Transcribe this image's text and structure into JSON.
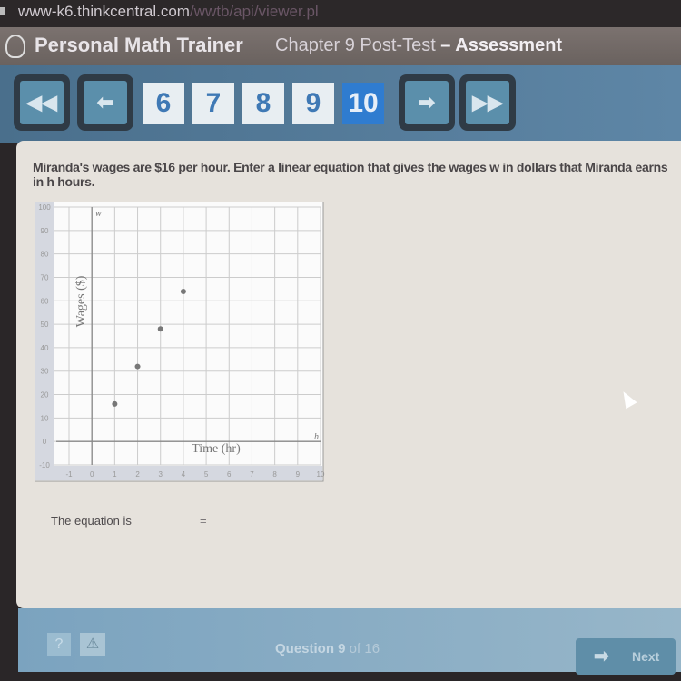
{
  "browser": {
    "url_host": "www-k6.thinkcentral.com",
    "url_path": "/wwtb/api/viewer.pl"
  },
  "header": {
    "app_title": "Personal Math Trainer",
    "chapter": "Chapter 9 Post-Test",
    "separator": " – ",
    "section": "Assessment"
  },
  "nav": {
    "first_icon": "double-left-arrow-icon",
    "prev_icon": "left-arrow-icon",
    "next_icon": "right-arrow-icon",
    "last_icon": "double-right-arrow-icon",
    "questions": [
      "6",
      "7",
      "8",
      "9",
      "10"
    ],
    "active_question": "10",
    "accent_color": "#2f7cd0"
  },
  "question": {
    "text": "Miranda's wages are $16 per hour. Enter a linear equation that gives the wages w in dollars that Miranda earns in h hours."
  },
  "chart_data": {
    "type": "scatter",
    "xlabel": "Time (hr)",
    "ylabel": "Wages ($)",
    "x_axis_var": "h",
    "y_axis_var": "w",
    "xlim": [
      -1,
      10
    ],
    "ylim": [
      -10,
      100
    ],
    "x_ticks": [
      "-1",
      "0",
      "1",
      "2",
      "3",
      "4",
      "5",
      "6",
      "7",
      "8",
      "9",
      "10"
    ],
    "y_ticks": [
      "100",
      "90",
      "80",
      "70",
      "60",
      "50",
      "40",
      "30",
      "20",
      "10",
      "0",
      "-10"
    ],
    "grid": true,
    "points": [
      {
        "x": 1,
        "y": 16
      },
      {
        "x": 2,
        "y": 32
      },
      {
        "x": 3,
        "y": 48
      },
      {
        "x": 4,
        "y": 64
      }
    ]
  },
  "answer": {
    "label": "The equation is",
    "equals": "=",
    "left_value": "",
    "right_value": ""
  },
  "footer": {
    "help_label": "?",
    "warn_icon": "warning-icon",
    "question_word": "Question 9",
    "question_of": " of 16",
    "next_label": "Next",
    "next_icon": "right-arrow-icon"
  }
}
